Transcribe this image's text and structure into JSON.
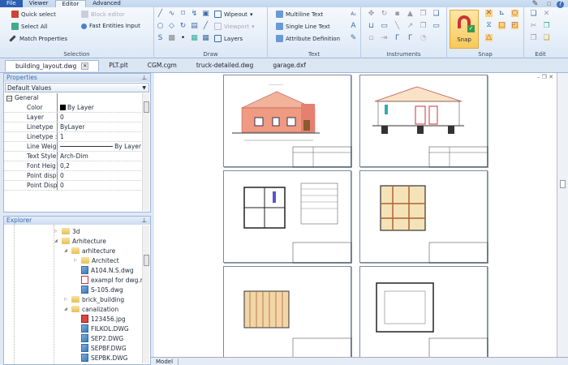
{
  "menu": {
    "tabs": [
      "File",
      "Viewer",
      "Editor",
      "Advanced"
    ],
    "active": "Editor"
  },
  "ribbon": {
    "selection": {
      "label": "Selection",
      "quick_select": "Quick select",
      "select_all": "Select All",
      "match_properties": "Match Properties",
      "block_editor": "Block editor",
      "fast_entities": "Fast Entities Input"
    },
    "draw": {
      "label": "Draw",
      "wipeout": "Wipeout",
      "viewport": "Viewport",
      "layers": "Layers"
    },
    "text": {
      "label": "Text",
      "multiline": "Multiline Text",
      "single_line": "Single Line Text",
      "attribute": "Attribute Definition"
    },
    "instruments": {
      "label": "Instruments"
    },
    "snap": {
      "label": "Snap",
      "button": "Snap"
    },
    "edit": {
      "label": "Edit"
    }
  },
  "doc_tabs": [
    "building_layout.dwg",
    "PLT.plt",
    "CGM.cgm",
    "truck-detailed.dwg",
    "garage.dxf"
  ],
  "properties": {
    "title": "Properties",
    "dropdown": "Default Values",
    "section": "General",
    "rows": [
      {
        "name": "Color",
        "value": "By Layer"
      },
      {
        "name": "Layer",
        "value": "0"
      },
      {
        "name": "Linetype",
        "value": "ByLayer"
      },
      {
        "name": "Linetype :",
        "value": "1"
      },
      {
        "name": "Line Weig",
        "value": "By Layer"
      },
      {
        "name": "Text Style",
        "value": "Arch-Dim"
      },
      {
        "name": "Font Heig",
        "value": "0,2"
      },
      {
        "name": "Point disp",
        "value": "0"
      },
      {
        "name": "Point Disp",
        "value": "0"
      }
    ]
  },
  "explorer": {
    "title": "Explorer",
    "items": [
      {
        "label": "3d",
        "type": "folder",
        "level": 0,
        "exp": "▷"
      },
      {
        "label": "Arhitecture",
        "type": "folder",
        "level": 0,
        "exp": "◢"
      },
      {
        "label": "arhitecture",
        "type": "folder",
        "level": 1,
        "exp": "◢"
      },
      {
        "label": "Architect",
        "type": "folder",
        "level": 2,
        "exp": "▷"
      },
      {
        "label": "A104.N.S.dwg",
        "type": "dwg",
        "level": 2,
        "exp": ""
      },
      {
        "label": "exampl for dwg.ru",
        "type": "pdf",
        "level": 2,
        "exp": ""
      },
      {
        "label": "S-105.dwg",
        "type": "dwg",
        "level": 2,
        "exp": ""
      },
      {
        "label": "brick_building",
        "type": "folder",
        "level": 1,
        "exp": "▷"
      },
      {
        "label": "canalization",
        "type": "folder",
        "level": 1,
        "exp": "◢"
      },
      {
        "label": "123456.jpg",
        "type": "jpg",
        "level": 2,
        "exp": ""
      },
      {
        "label": "FILKOL.DWG",
        "type": "dwg",
        "level": 2,
        "exp": ""
      },
      {
        "label": "SEP2.DWG",
        "type": "dwg",
        "level": 2,
        "exp": ""
      },
      {
        "label": "SEPBF.DWG",
        "type": "dwg",
        "level": 2,
        "exp": ""
      },
      {
        "label": "SEPBK.DWG",
        "type": "dwg",
        "level": 2,
        "exp": ""
      }
    ]
  },
  "bottom_tabs": [
    "Model"
  ],
  "colors": {
    "accent": "#2b5fb0",
    "snap": "#f8c95a",
    "wall": "#f09a82"
  }
}
